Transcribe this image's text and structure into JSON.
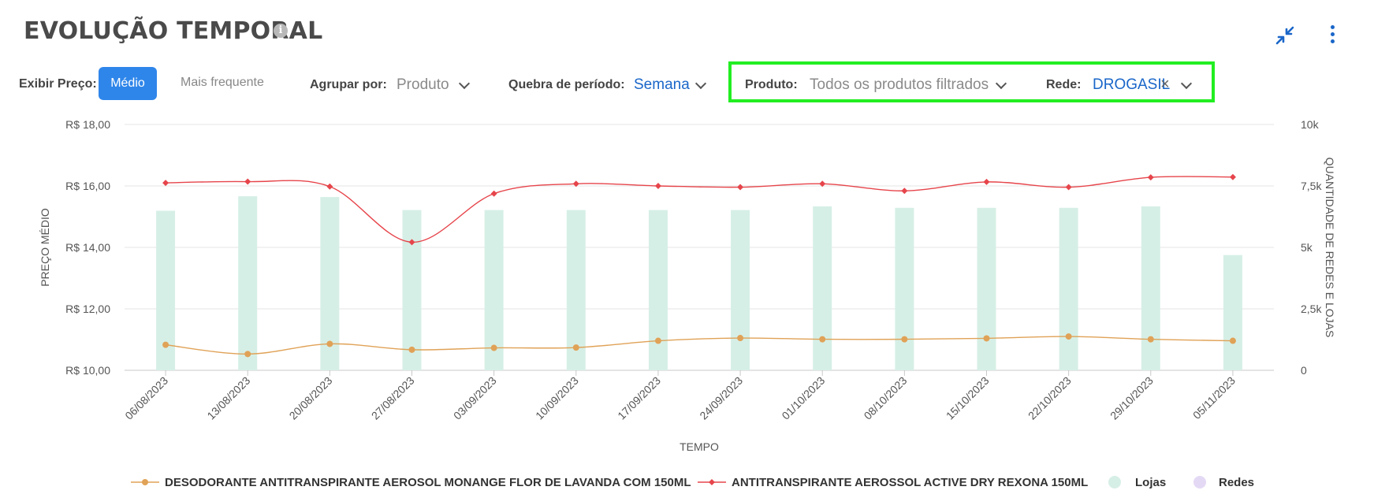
{
  "header": {
    "title": "EVOLUÇÃO TEMPORAL",
    "info_icon": "info-icon",
    "collapse_icon": "collapse-icon",
    "menu_icon": "more-vertical-icon"
  },
  "toolbar": {
    "price_label": "Exibir Preço:",
    "price_options": [
      "Médio",
      "Mais frequente"
    ],
    "price_selected": "Médio",
    "group_label": "Agrupar por:",
    "group_value": "Produto",
    "period_label": "Quebra de período:",
    "period_value": "Semana",
    "product_label": "Produto:",
    "product_value": "Todos os produtos filtrados",
    "network_label": "Rede:",
    "network_value": "DROGASIL"
  },
  "colors": {
    "accent": "#2f86ea",
    "highlight_box": "#22ee22",
    "series_orange": "#e0a257",
    "series_red": "#e6454b",
    "bars": "#d6efe6",
    "redes": "#e4d9f5"
  },
  "chart_data": {
    "type": "bar+line",
    "xlabel": "TEMPO",
    "ylabel": "PREÇO MÉDIO",
    "y2label": "QUANTIDADE DE REDES E LOJAS",
    "categories": [
      "06/08/2023",
      "13/08/2023",
      "20/08/2023",
      "27/08/2023",
      "03/09/2023",
      "10/09/2023",
      "17/09/2023",
      "24/09/2023",
      "01/10/2023",
      "08/10/2023",
      "15/10/2023",
      "22/10/2023",
      "29/10/2023",
      "05/11/2023"
    ],
    "ylim": [
      10,
      18
    ],
    "y_ticks": [
      "R$ 10,00",
      "R$ 12,00",
      "R$ 14,00",
      "R$ 16,00",
      "R$ 18,00"
    ],
    "y_tick_values": [
      10,
      12,
      14,
      16,
      18
    ],
    "y2lim": [
      0,
      10000
    ],
    "y2_ticks": [
      "0",
      "2,5k",
      "5k",
      "7,5k",
      "10k"
    ],
    "y2_tick_values": [
      0,
      2500,
      5000,
      7500,
      10000
    ],
    "series": [
      {
        "name": "DESODORANTE ANTITRANSPIRANTE AEROSOL MONANGE FLOR DE LAVANDA COM 150ML",
        "kind": "line",
        "axis": "left",
        "color": "#e0a257",
        "marker": "circle",
        "values": [
          10.83,
          10.53,
          10.86,
          10.67,
          10.73,
          10.74,
          10.96,
          11.05,
          11.01,
          11.01,
          11.04,
          11.1,
          11.01,
          10.96
        ]
      },
      {
        "name": "ANTITRANSPIRANTE AEROSSOL ACTIVE DRY REXONA 150ML",
        "kind": "line",
        "axis": "left",
        "color": "#e6454b",
        "marker": "diamond",
        "values": [
          16.1,
          16.14,
          15.98,
          14.17,
          15.75,
          16.07,
          16.0,
          15.96,
          16.07,
          15.84,
          16.13,
          15.96,
          16.28,
          16.29
        ]
      },
      {
        "name": "Lojas",
        "kind": "bar",
        "axis": "right",
        "color": "#d6efe6",
        "values": [
          6490,
          7080,
          7050,
          6520,
          6520,
          6520,
          6520,
          6520,
          6670,
          6610,
          6610,
          6610,
          6670,
          4690
        ]
      },
      {
        "name": "Redes",
        "kind": "bar",
        "axis": "right",
        "color": "#e4d9f5",
        "values": [
          1,
          1,
          1,
          1,
          1,
          1,
          1,
          1,
          1,
          1,
          1,
          1,
          1,
          1
        ]
      }
    ],
    "legend": [
      "DESODORANTE ANTITRANSPIRANTE AEROSOL MONANGE FLOR DE LAVANDA COM 150ML",
      "ANTITRANSPIRANTE AEROSSOL ACTIVE DRY REXONA 150ML",
      "Lojas",
      "Redes"
    ],
    "legend_position": "bottom",
    "grid": true
  }
}
